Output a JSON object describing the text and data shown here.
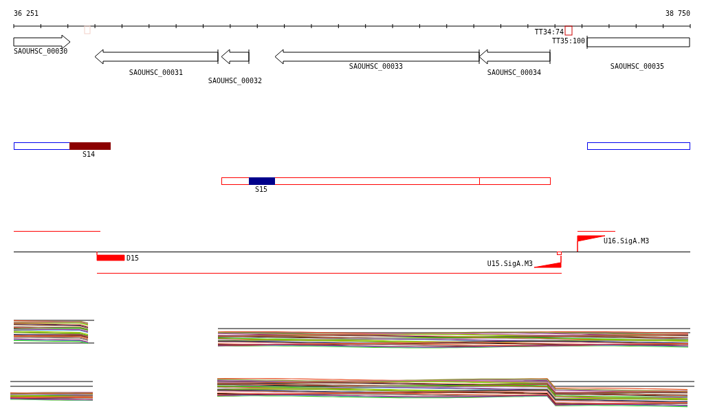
{
  "ruler": {
    "start_label": "36 251",
    "end_label": "38 750"
  },
  "genes": [
    {
      "label": "SAOUHSC_00030",
      "kind": "forward"
    },
    {
      "label": "SAOUHSC_00031",
      "kind": "reverse"
    },
    {
      "label": "SAOUHSC_00032",
      "kind": "reverse"
    },
    {
      "label": "SAOUHSC_00033",
      "kind": "reverse"
    },
    {
      "label": "SAOUHSC_00034",
      "kind": "reverse"
    },
    {
      "label": "SAOUHSC_00035",
      "kind": "box"
    }
  ],
  "terminators": [
    {
      "label": "TT34:74"
    },
    {
      "label": "TT35:100"
    }
  ],
  "segments": [
    {
      "label": "S14",
      "color": "#8b0000"
    },
    {
      "label": "S15",
      "color": "#00008b"
    }
  ],
  "signals": [
    {
      "label": "D15",
      "kind": "block"
    },
    {
      "label": "U15.SigA.M3",
      "kind": "promoter"
    },
    {
      "label": "U16.SigA.M3",
      "kind": "promoter"
    }
  ]
}
